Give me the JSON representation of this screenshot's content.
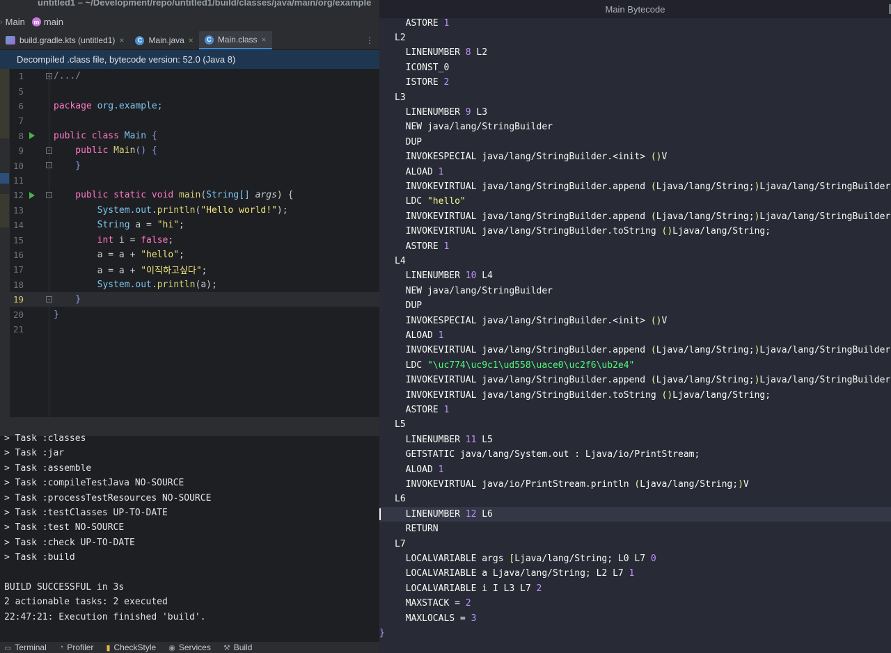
{
  "window": {
    "title": "untitled1 – ~/Development/repo/untitled1/build/classes/java/main/org/example"
  },
  "breadcrumb": {
    "items": [
      "Main",
      "main"
    ]
  },
  "tabs": [
    {
      "label": "build.gradle.kts (untitled1)",
      "close": "×"
    },
    {
      "label": "Main.java",
      "close": "×"
    },
    {
      "label": "Main.class",
      "close": "×"
    }
  ],
  "tabs_more_glyph": "⋮",
  "banner": {
    "text": "Decompiled .class file, bytecode version: 52.0 (Java 8)"
  },
  "editor": {
    "line_numbers": [
      "1",
      "5",
      "6",
      "7",
      "8",
      "9",
      "10",
      "11",
      "12",
      "13",
      "14",
      "15",
      "16",
      "17",
      "18",
      "19",
      "20",
      "21"
    ],
    "current_line": "19",
    "code": {
      "l1": "/.../",
      "l6_kw": "package",
      "l6_pkg": " org.example;",
      "l8_kw": "public class",
      "l8_cls": " Main ",
      "l8_brace": "{",
      "l9_kw": "    public",
      "l9_fn": " Main",
      "l9_rest": "() {",
      "l10": "    }",
      "l12_kw": "    public static void",
      "l12_fn": " main",
      "l12_open": "(",
      "l12_type": "String[]",
      "l12_param": " args",
      "l12_close": ") {",
      "l13_a": "        System.",
      "l13_field": "out",
      "l13_b": ".",
      "l13_fn": "println",
      "l13_c": "(",
      "l13_str": "\"Hello world!\"",
      "l13_d": ");",
      "l14_type": "        String",
      "l14_a": " a = ",
      "l14_str": "\"hi\"",
      "l14_end": ";",
      "l15_kw": "        int",
      "l15_a": " i = ",
      "l15_bool": "false",
      "l15_end": ";",
      "l16_a": "        a = a + ",
      "l16_str": "\"hello\"",
      "l16_end": ";",
      "l17_a": "        a = a + ",
      "l17_str": "\"이직하고싶다\"",
      "l17_end": ";",
      "l18_a": "        System.",
      "l18_field": "out",
      "l18_b": ".",
      "l18_fn": "println",
      "l18_c": "(a);",
      "l19": "    }",
      "l20": "}"
    }
  },
  "console": {
    "lines": [
      "> Task :classes",
      "> Task :jar",
      "> Task :assemble",
      "> Task :compileTestJava NO-SOURCE",
      "> Task :processTestResources NO-SOURCE",
      "> Task :testClasses UP-TO-DATE",
      "> Task :test NO-SOURCE",
      "> Task :check UP-TO-DATE",
      "> Task :build",
      "",
      "BUILD SUCCESSFUL in 3s",
      "2 actionable tasks: 2 executed",
      "22:47:21: Execution finished 'build'."
    ]
  },
  "statusbar": {
    "items": [
      "Terminal",
      "Profiler",
      "CheckStyle",
      "Services",
      "Build"
    ]
  },
  "bytecode": {
    "title": "Main Bytecode",
    "lines": [
      {
        "pre": "  ASTORE ",
        "num": "1"
      },
      {
        "pre": "L2"
      },
      {
        "pre": "  LINENUMBER ",
        "num": "8",
        "post": " L2"
      },
      {
        "pre": "  ICONST_0"
      },
      {
        "pre": "  ISTORE ",
        "num": "2"
      },
      {
        "pre": "L3"
      },
      {
        "pre": "  LINENUMBER ",
        "num": "9",
        "post": " L3"
      },
      {
        "pre": "  NEW java/lang/StringBuilder"
      },
      {
        "pre": "  DUP"
      },
      {
        "pre": "  INVOKESPECIAL java/lang/StringBuilder.<init> ",
        "paren": "()",
        "post": "V"
      },
      {
        "pre": "  ALOAD ",
        "num": "1"
      },
      {
        "pre": "  INVOKEVIRTUAL java/lang/StringBuilder.append ",
        "paren": "(",
        "mid": "Ljava/lang/String;",
        "paren2": ")",
        "post": "Ljava/lang/StringBuilder;"
      },
      {
        "pre": "  LDC ",
        "str": "\"hello\""
      },
      {
        "pre": "  INVOKEVIRTUAL java/lang/StringBuilder.append ",
        "paren": "(",
        "mid": "Ljava/lang/String;",
        "paren2": ")",
        "post": "Ljava/lang/StringBuilder;"
      },
      {
        "pre": "  INVOKEVIRTUAL java/lang/StringBuilder.toString ",
        "paren": "()",
        "post": "Ljava/lang/String;"
      },
      {
        "pre": "  ASTORE ",
        "num": "1"
      },
      {
        "pre": "L4"
      },
      {
        "pre": "  LINENUMBER ",
        "num": "10",
        "post": " L4"
      },
      {
        "pre": "  NEW java/lang/StringBuilder"
      },
      {
        "pre": "  DUP"
      },
      {
        "pre": "  INVOKESPECIAL java/lang/StringBuilder.<init> ",
        "paren": "()",
        "post": "V"
      },
      {
        "pre": "  ALOAD ",
        "num": "1"
      },
      {
        "pre": "  INVOKEVIRTUAL java/lang/StringBuilder.append ",
        "paren": "(",
        "mid": "Ljava/lang/String;",
        "paren2": ")",
        "post": "Ljava/lang/StringBuilder;"
      },
      {
        "pre": "  LDC ",
        "green": "\"\\uc774\\uc9c1\\ud558\\uace0\\uc2f6\\ub2e4\""
      },
      {
        "pre": "  INVOKEVIRTUAL java/lang/StringBuilder.append ",
        "paren": "(",
        "mid": "Ljava/lang/String;",
        "paren2": ")",
        "post": "Ljava/lang/StringBuilder;"
      },
      {
        "pre": "  INVOKEVIRTUAL java/lang/StringBuilder.toString ",
        "paren": "()",
        "post": "Ljava/lang/String;"
      },
      {
        "pre": "  ASTORE ",
        "num": "1"
      },
      {
        "pre": "L5"
      },
      {
        "pre": "  LINENUMBER ",
        "num": "11",
        "post": " L5"
      },
      {
        "pre": "  GETSTATIC java/lang/System.out : Ljava/io/PrintStream;"
      },
      {
        "pre": "  ALOAD ",
        "num": "1"
      },
      {
        "pre": "  INVOKEVIRTUAL java/io/PrintStream.println ",
        "paren": "(",
        "mid": "Ljava/lang/String;",
        "paren2": ")",
        "post": "V"
      },
      {
        "pre": "L6"
      },
      {
        "pre": "  LINENUMBER ",
        "num": "12",
        "post": " L6",
        "current": true
      },
      {
        "pre": "  RETURN"
      },
      {
        "pre": "L7"
      },
      {
        "pre": "  LOCALVARIABLE args ",
        "paren": "[",
        "post": "Ljava/lang/String; L0 L7 ",
        "num2": "0"
      },
      {
        "pre": "  LOCALVARIABLE a Ljava/lang/String; L2 L7 ",
        "num": "1"
      },
      {
        "pre": "  LOCALVARIABLE i I L3 L7 ",
        "num": "2"
      },
      {
        "pre": "  MAXSTACK = ",
        "num": "2"
      },
      {
        "pre": "  MAXLOCALS = ",
        "num": "3"
      },
      {
        "pre": "}"
      }
    ]
  },
  "colors": {
    "accent": "#3d8bd6",
    "banner_bg": "#1f3650",
    "run_gutter": "#4caf50",
    "bytecode_number": "#bd93f9",
    "bytecode_string": "#f1fa8c",
    "bytecode_unicode_string": "#50fa7b"
  }
}
